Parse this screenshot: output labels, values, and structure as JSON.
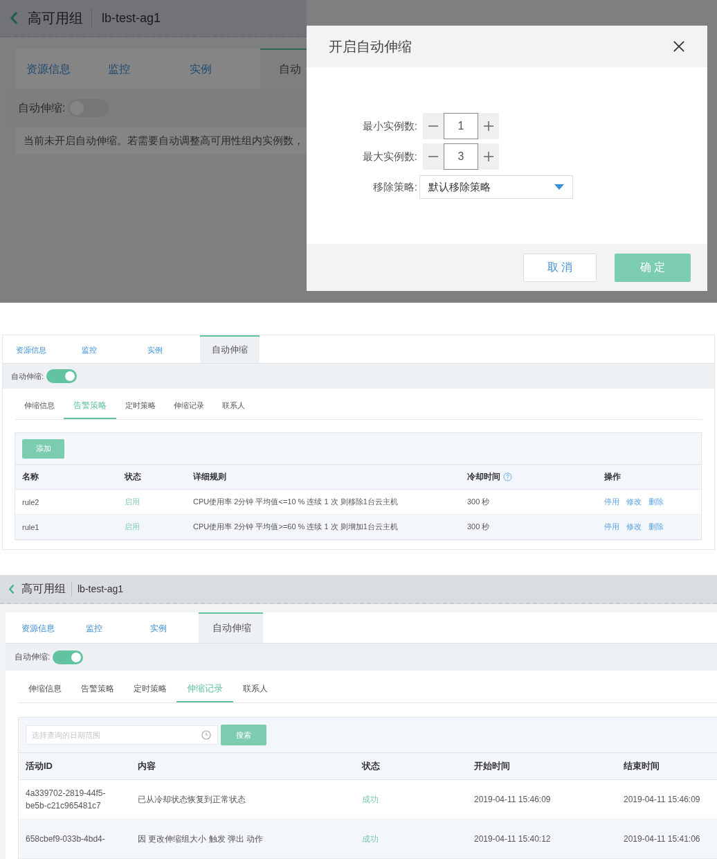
{
  "dialog_screen": {
    "header": {
      "title": "高可用组",
      "name": "lb-test-ag1"
    },
    "tabs": [
      {
        "label": "资源信息",
        "selected": false
      },
      {
        "label": "监控",
        "selected": false
      },
      {
        "label": "实例",
        "selected": false
      },
      {
        "label": "自动",
        "selected": true
      }
    ],
    "auto_scaling": {
      "label": "自动伸缩:",
      "on": false
    },
    "notice": "当前未开启自动伸缩。若需要自动调整高可用性组内实例数，",
    "dialog": {
      "title": "开启自动伸缩",
      "fields": [
        {
          "kind": "stepper",
          "label": "最小实例数:",
          "value": "1"
        },
        {
          "kind": "stepper",
          "label": "最大实例数:",
          "value": "3"
        },
        {
          "kind": "select",
          "label": "移除策略:",
          "value": "默认移除策略"
        }
      ],
      "buttons": [
        {
          "label": "取 消",
          "kind": "secondary"
        },
        {
          "label": "确 定",
          "kind": "primary"
        }
      ]
    }
  },
  "alert_policy_screen": {
    "tabs": [
      {
        "label": "资源信息",
        "selected": false
      },
      {
        "label": "监控",
        "selected": false
      },
      {
        "label": "实例",
        "selected": false
      },
      {
        "label": "自动伸缩",
        "selected": true
      }
    ],
    "auto_scaling": {
      "label": "自动伸缩:",
      "on": true
    },
    "sub_tabs": [
      {
        "label": "伸缩信息",
        "selected": false
      },
      {
        "label": "告警策略",
        "selected": true
      },
      {
        "label": "定时策略",
        "selected": false
      },
      {
        "label": "伸缩记录",
        "selected": false
      },
      {
        "label": "联系人",
        "selected": false
      }
    ],
    "add_button": "添加",
    "table": {
      "columns": [
        {
          "label": "名称",
          "help": false
        },
        {
          "label": "状态",
          "help": false
        },
        {
          "label": "详细规则",
          "help": false
        },
        {
          "label": "冷却时间",
          "help": true
        },
        {
          "label": "操作",
          "help": false
        }
      ],
      "rows": [
        {
          "name": "rule2",
          "status": "启用",
          "rule": "CPU使用率 2分钟 平均值<=10 % 连续 1 次 则移除1台云主机",
          "cooldown": "300 秒",
          "actions": [
            "停用",
            "修改",
            "删除"
          ]
        },
        {
          "name": "rule1",
          "status": "启用",
          "rule": "CPU使用率 2分钟 平均值>=60 % 连续 1 次 则增加1台云主机",
          "cooldown": "300 秒",
          "actions": [
            "停用",
            "修改",
            "删除"
          ]
        }
      ]
    }
  },
  "scaling_record_screen": {
    "header": {
      "title": "高可用组",
      "name": "lb-test-ag1"
    },
    "tabs": [
      {
        "label": "资源信息",
        "selected": false
      },
      {
        "label": "监控",
        "selected": false
      },
      {
        "label": "实例",
        "selected": false
      },
      {
        "label": "自动伸缩",
        "selected": true
      }
    ],
    "auto_scaling": {
      "label": "自动伸缩:",
      "on": true
    },
    "sub_tabs": [
      {
        "label": "伸缩信息",
        "selected": false
      },
      {
        "label": "告警策略",
        "selected": false
      },
      {
        "label": "定时策略",
        "selected": false
      },
      {
        "label": "伸缩记录",
        "selected": true
      },
      {
        "label": "联系人",
        "selected": false
      }
    ],
    "search": {
      "placeholder": "选择查询的日期范围",
      "button": "搜索"
    },
    "table": {
      "columns": [
        "活动ID",
        "内容",
        "状态",
        "开始时间",
        "结束时间"
      ],
      "rows": [
        {
          "activity_id": [
            "4a339702-2819-44f5-",
            "be5b-c21c965481c7"
          ],
          "content": "已从冷却状态恢复到正常状态",
          "status": "成功",
          "start": "2019-04-11 15:46:09",
          "end": "2019-04-11 15:46:09"
        },
        {
          "activity_id": [
            "658cbef9-033b-4bd4-"
          ],
          "content": "因 更改伸缩组大小 触发 弹出 动作",
          "status": "成功",
          "start": "2019-04-11 15:40:12",
          "end": "2019-04-11 15:41:06"
        }
      ]
    }
  }
}
